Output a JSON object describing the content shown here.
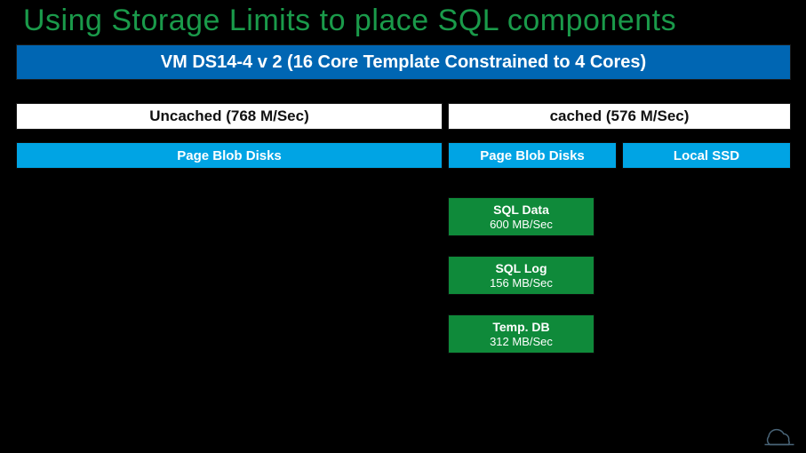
{
  "title": "Using Storage Limits to place SQL components",
  "vm_band": "VM DS14-4 v 2 (16 Core Template Constrained to 4 Cores)",
  "cache": {
    "uncached": "Uncached (768 M/Sec)",
    "cached": "cached (576 M/Sec)"
  },
  "disks": {
    "left": "Page Blob Disks",
    "mid": "Page Blob Disks",
    "right": "Local SSD"
  },
  "sql": {
    "data": {
      "name": "SQL Data",
      "rate": "600 MB/Sec"
    },
    "log": {
      "name": "SQL Log",
      "rate": "156  MB/Sec"
    },
    "tmp": {
      "name": "Temp. DB",
      "rate": "312 MB/Sec"
    }
  },
  "colors": {
    "title_green": "#1a9a4a",
    "deep_blue": "#0066b3",
    "light_blue": "#00a4e4",
    "box_green": "#0f8a3a"
  }
}
